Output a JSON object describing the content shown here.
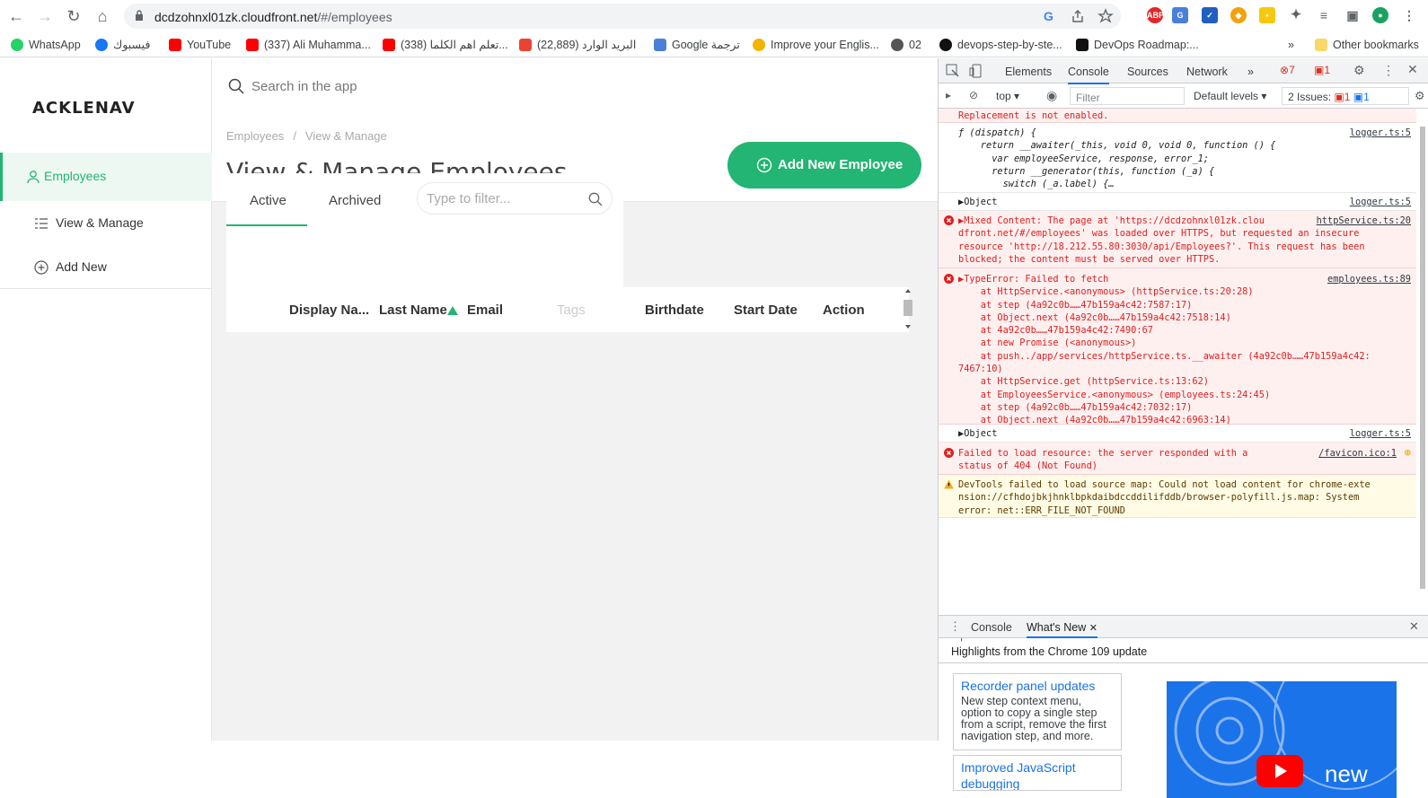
{
  "browser": {
    "url_host": "dcdzohnxl01zk.cloudfront.net",
    "url_path": "/#/employees",
    "bookmarks": [
      "WhatsApp",
      "فيسبوك",
      "YouTube",
      "(337) Ali Muhamma...",
      "(338) تعلم اهم الكلما...",
      "(22,889) البريد الوارد",
      "Google ترجمة",
      "Improve your Englis...",
      "02",
      "devops-step-by-ste...",
      "DevOps Roadmap:...",
      "»",
      "Other bookmarks"
    ]
  },
  "sidebar": {
    "logo": "ACKLENAV",
    "items": [
      {
        "label": "Employees"
      },
      {
        "label": "View & Manage"
      },
      {
        "label": "Add New"
      }
    ]
  },
  "header": {
    "search_placeholder": "Search in the app",
    "breadcrumb": [
      "Employees",
      "/",
      "View & Manage"
    ],
    "title": "View & Manage Employees",
    "add_button": "Add New Employee"
  },
  "card": {
    "tabs": [
      "Active",
      "Archived"
    ],
    "filter_placeholder": "Type to filter...",
    "columns": [
      "Display Na...",
      "Last Name",
      "Email",
      "Tags",
      "Birthdate",
      "Start Date",
      "Action"
    ]
  },
  "devtools": {
    "tabs": [
      "Elements",
      "Console",
      "Sources",
      "Network",
      "»"
    ],
    "error_count": "7",
    "issue_badge": "1",
    "toolbar": {
      "context": "top",
      "filter_placeholder": "Filter",
      "levels": "Default levels",
      "issues": "2 Issues:",
      "issues_err": "1",
      "issues_info": "1"
    },
    "messages": [
      {
        "text": "Replacement is not enabled."
      },
      {
        "text": "ƒ (dispatch) {\n    return __awaiter(_this, void 0, void 0, function () {\n      var employeeService, response, error_1;\n      return __generator(this, function (_a) {\n        switch (_a.label) {…",
        "src": "logger.ts:5"
      },
      {
        "text": "▶Object",
        "src": "logger.ts:5"
      },
      {
        "text": "▶Mixed Content: The page at 'https://dcdzohnxl01zk.clou\ndfront.net/#/employees' was loaded over HTTPS, but requested an insecure\nresource 'http://18.212.55.80:3030/api/Employees?'. This request has been\nblocked; the content must be served over HTTPS.",
        "src": "httpService.ts:20"
      },
      {
        "text": "▶TypeError: Failed to fetch\n    at HttpService.<anonymous> (httpService.ts:20:28)\n    at step (4a92c0b……47b159a4c42:7587:17)\n    at Object.next (4a92c0b……47b159a4c42:7518:14)\n    at 4a92c0b……47b159a4c42:7490:67\n    at new Promise (<anonymous>)\n    at push../app/services/httpService.ts.__awaiter (4a92c0b……47b159a4c42:\n7467:10)\n    at HttpService.get (httpService.ts:13:62)\n    at EmployeesService.<anonymous> (employees.ts:24:45)\n    at step (4a92c0b……47b159a4c42:7032:17)\n    at Object.next (4a92c0b……47b159a4c42:6963:14)",
        "src": "employees.ts:89"
      },
      {
        "text": "▶Object",
        "src": "logger.ts:5"
      },
      {
        "text": "Failed to load resource: the server responded with a\nstatus of 404 (Not Found)",
        "src": "/favicon.ico:1"
      },
      {
        "text": "DevTools failed to load source map: Could not load content for chrome-exte\nnsion://cfhdojbkjhnklbpkdaibdccddilifddb/browser-polyfill.js.map: System\nerror: net::ERR_FILE_NOT_FOUND"
      }
    ],
    "drawer": {
      "tabs": [
        "Console",
        "What's New"
      ],
      "heading": "Highlights from the Chrome 109 update",
      "cards": [
        {
          "title": "Recorder panel updates",
          "body": "New step context menu, option to copy a single step from a script, remove the first navigation step, and more."
        },
        {
          "title": "Improved JavaScript debugging",
          "body": ""
        }
      ],
      "video_label": "new"
    }
  }
}
